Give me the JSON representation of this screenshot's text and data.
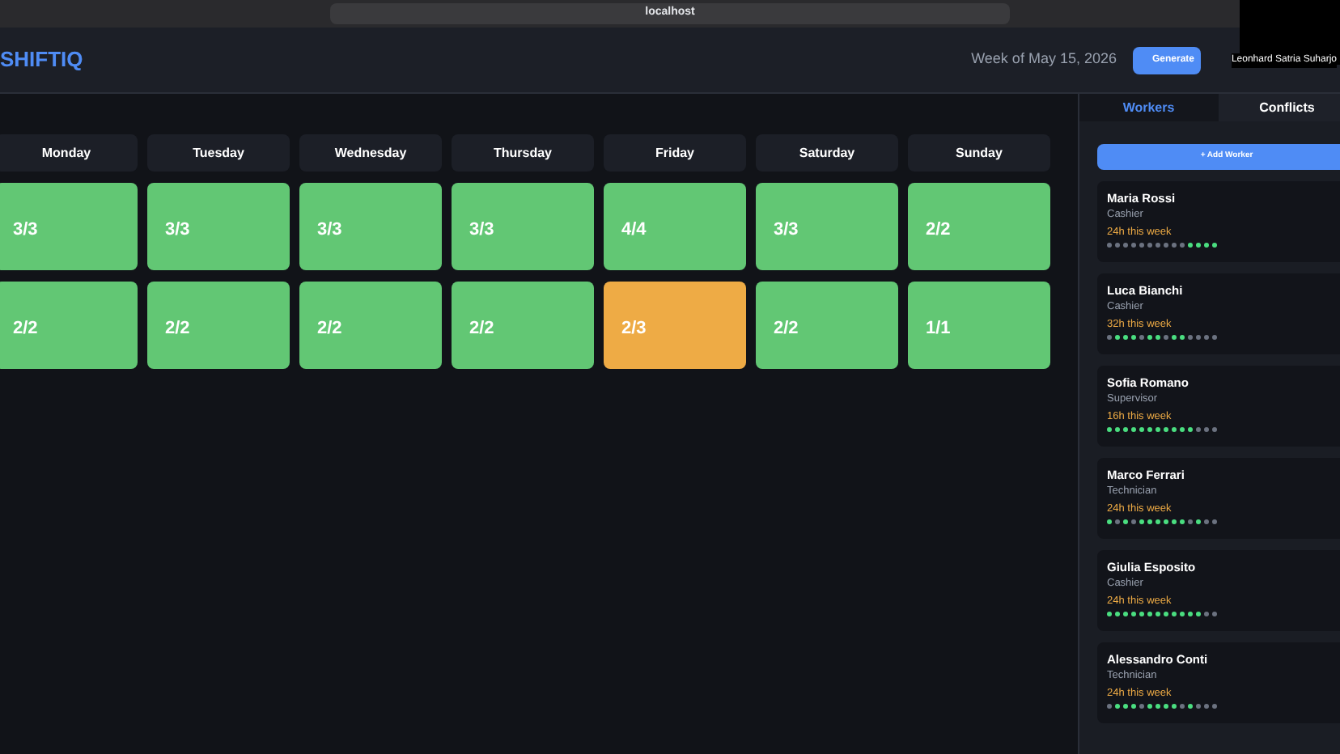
{
  "browser": {
    "address": "localhost"
  },
  "header": {
    "logo": "SHIFTIQ",
    "week": "Week of May 15, 2026",
    "generate_button": "Generate"
  },
  "webcam": {
    "name": "Leonhard Satria Suharjo"
  },
  "days": [
    "Monday",
    "Tuesday",
    "Wednesday",
    "Thursday",
    "Friday",
    "Saturday",
    "Sunday"
  ],
  "shift_rows": [
    {
      "cells": [
        {
          "count": "3/3",
          "full": true
        },
        {
          "count": "3/3",
          "full": true
        },
        {
          "count": "3/3",
          "full": true
        },
        {
          "count": "3/3",
          "full": true
        },
        {
          "count": "4/4",
          "full": true
        },
        {
          "count": "3/3",
          "full": true
        },
        {
          "count": "2/2",
          "full": true
        }
      ]
    },
    {
      "cells": [
        {
          "count": "2/2",
          "full": true
        },
        {
          "count": "2/2",
          "full": true
        },
        {
          "count": "2/2",
          "full": true
        },
        {
          "count": "2/2",
          "full": true
        },
        {
          "count": "2/3",
          "full": false
        },
        {
          "count": "2/2",
          "full": true
        },
        {
          "count": "1/1",
          "full": true
        }
      ]
    }
  ],
  "sidebar": {
    "tabs": [
      {
        "label": "Workers",
        "selected": true
      },
      {
        "label": "Conflicts",
        "selected": false
      }
    ],
    "add_button": "+ Add Worker",
    "workers": [
      {
        "name": "Maria Rossi",
        "role": "Cashier",
        "hours": "24h this week",
        "slots": [
          false,
          false,
          false,
          false,
          false,
          false,
          false,
          false,
          false,
          false,
          true,
          true,
          true,
          true
        ]
      },
      {
        "name": "Luca Bianchi",
        "role": "Cashier",
        "hours": "32h this week",
        "slots": [
          false,
          true,
          true,
          true,
          false,
          true,
          true,
          false,
          true,
          true,
          false,
          false,
          false,
          false
        ]
      },
      {
        "name": "Sofia Romano",
        "role": "Supervisor",
        "hours": "16h this week",
        "slots": [
          true,
          true,
          true,
          true,
          true,
          true,
          true,
          true,
          true,
          true,
          true,
          false,
          false,
          false
        ]
      },
      {
        "name": "Marco Ferrari",
        "role": "Technician",
        "hours": "24h this week",
        "slots": [
          true,
          false,
          true,
          false,
          true,
          true,
          true,
          true,
          true,
          true,
          false,
          true,
          false,
          false
        ]
      },
      {
        "name": "Giulia Esposito",
        "role": "Cashier",
        "hours": "24h this week",
        "slots": [
          true,
          true,
          true,
          true,
          true,
          true,
          true,
          true,
          true,
          true,
          true,
          true,
          false,
          false
        ]
      },
      {
        "name": "Alessandro Conti",
        "role": "Technician",
        "hours": "24h this week",
        "slots": [
          false,
          true,
          true,
          true,
          false,
          true,
          true,
          true,
          true,
          false,
          true,
          false,
          false,
          false
        ]
      }
    ]
  }
}
